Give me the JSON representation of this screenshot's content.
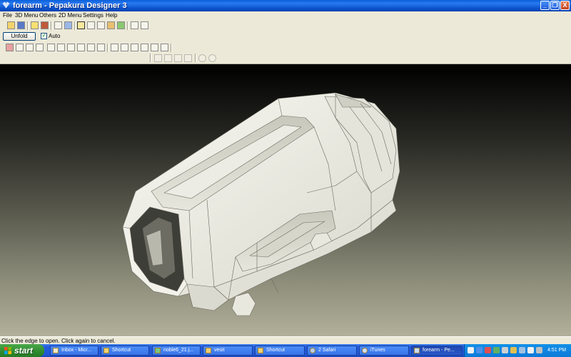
{
  "window": {
    "title": "forearm - Pepakura Designer 3",
    "minimize": "_",
    "maximize": "❐",
    "close": "X"
  },
  "menu": [
    "File",
    "3D Menu",
    "Others",
    "2D Menu",
    "Settings",
    "Help"
  ],
  "toolbar": {
    "unfold_label": "Unfold",
    "auto_label": "Auto",
    "auto_checked": true
  },
  "status": "Click the edge to open. Click again to cancel.",
  "taskbar": {
    "start_label": "start",
    "tasks": [
      {
        "label": "Inbox - Micr...",
        "icon": "email-icon"
      },
      {
        "label": "Shortcut",
        "icon": "folder-icon"
      },
      {
        "label": "noble6_21.j...",
        "icon": "image-icon"
      },
      {
        "label": "vesit",
        "icon": "folder-icon"
      },
      {
        "label": "Shortcut",
        "icon": "folder-icon"
      },
      {
        "label": "2 Safari",
        "icon": "compass-icon"
      },
      {
        "label": "iTunes",
        "icon": "itunes-icon"
      },
      {
        "label": "forearm - Pe...",
        "icon": "pepakura-icon",
        "active": true
      }
    ],
    "clock": "4:51 PM"
  },
  "colors": {
    "taskbar_blue": "#245edb",
    "start_green": "#3a9a3a",
    "model_white": "#eeeee6"
  }
}
